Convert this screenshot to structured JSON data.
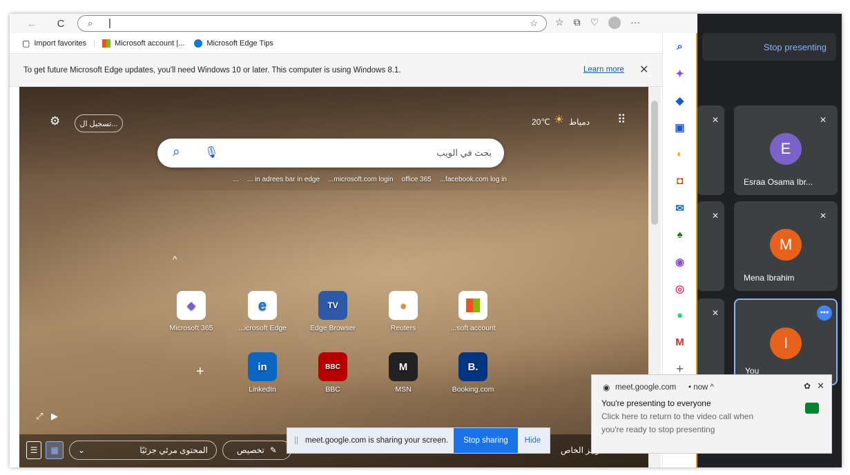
{
  "browser": {
    "address_text": "",
    "favorites": [
      "Import favorites",
      "Microsoft account |...",
      "Microsoft Edge Tips"
    ],
    "notice": {
      "text": "To get future Microsoft Edge updates, you'll need Windows 10 or later. This computer is using Windows 8.1.",
      "link": "Learn more",
      "close": "✕"
    }
  },
  "ntp": {
    "signin": "تسجيل ال...",
    "weather_temp": "20℃",
    "weather_city": "دمياط",
    "search_placeholder": "بحث في الويب",
    "suggestions": [
      "...facebook.com log in",
      "office 365",
      "...microsoft.com login",
      "... in adrees bar in edge",
      "..."
    ],
    "apps_row1": [
      {
        "label": "Microsoft 365",
        "icon": "m365-icon",
        "glyph": "◆",
        "color": "#7b5cd6"
      },
      {
        "label": "...icrosoft Edge",
        "icon": "edge-icon",
        "glyph": "e",
        "color": "#0c7bd6"
      },
      {
        "label": "Edge Browser",
        "icon": "tv-icon",
        "glyph": "TV",
        "color": "#2d5aa8"
      },
      {
        "label": "Reuters",
        "icon": "reuters-icon",
        "glyph": "●",
        "color": "#f08a24"
      },
      {
        "label": "...soft account",
        "icon": "ms-logo-icon",
        "glyph": "■",
        "color": "#f25022"
      }
    ],
    "apps_row2": [
      {
        "label": "LinkedIn",
        "icon": "linkedin-icon",
        "glyph": "in",
        "color": "#0a66c2"
      },
      {
        "label": "BBC",
        "icon": "bbc-icon",
        "glyph": "BBC",
        "color": "#b80000"
      },
      {
        "label": "MSN",
        "icon": "msn-icon",
        "glyph": "M",
        "color": "#222"
      },
      {
        "label": "Booking.com",
        "icon": "booking-icon",
        "glyph": "B.",
        "color": "#003580"
      }
    ],
    "bottom": {
      "content": "المحتوى مرئي جزئيًا",
      "customize": "تخصيص",
      "brief": "موجز الخاص"
    }
  },
  "share_bar": {
    "text": "meet.google.com is sharing your screen.",
    "stop": "Stop sharing",
    "hide": "Hide"
  },
  "meet": {
    "stop_presenting": "Stop presenting",
    "participants": [
      {
        "name": "Esraa Osama Ibr...",
        "initial": "E",
        "color": "#7b62c9"
      },
      {
        "name": "Mena Ibrahim",
        "initial": "M",
        "color": "#e8611a"
      },
      {
        "name": "You",
        "initial": "I",
        "color": "#e8611a"
      }
    ]
  },
  "toast": {
    "source": "meet.google.com",
    "time": "• now ^",
    "title": "You're presenting to everyone",
    "body1": "Click here to return to the video call when",
    "body2": "you're ready to stop presenting"
  }
}
